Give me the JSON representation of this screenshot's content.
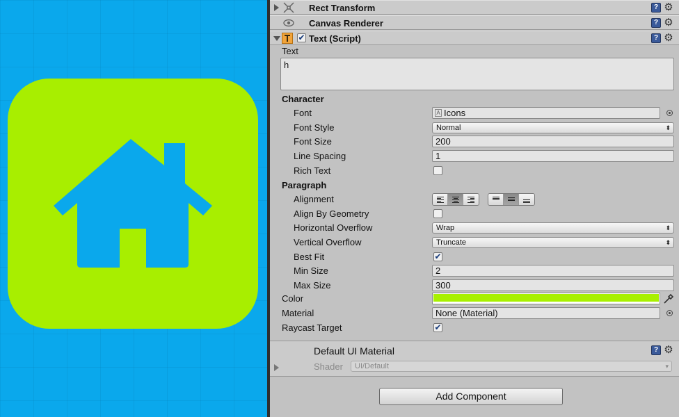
{
  "scene": {
    "background_color": "#0aa8ec",
    "tile_color": "#a8ee00",
    "icon": "house-icon"
  },
  "components": {
    "rect_transform": {
      "title": "Rect Transform",
      "icon": "rect-transform-icon"
    },
    "canvas_renderer": {
      "title": "Canvas Renderer",
      "icon": "eye-icon"
    },
    "text_script": {
      "title": "Text (Script)",
      "icon": "text-t-icon",
      "enabled": true
    }
  },
  "text_component": {
    "text_label": "Text",
    "text_value": "h",
    "character_header": "Character",
    "font_label": "Font",
    "font_value": "Icons",
    "font_style_label": "Font Style",
    "font_style_value": "Normal",
    "font_size_label": "Font Size",
    "font_size_value": "200",
    "line_spacing_label": "Line Spacing",
    "line_spacing_value": "1",
    "rich_text_label": "Rich Text",
    "rich_text_checked": false,
    "paragraph_header": "Paragraph",
    "alignment_label": "Alignment",
    "alignment_horizontal": "center",
    "alignment_vertical": "middle",
    "align_by_geometry_label": "Align By Geometry",
    "align_by_geometry_checked": false,
    "horizontal_overflow_label": "Horizontal Overflow",
    "horizontal_overflow_value": "Wrap",
    "vertical_overflow_label": "Vertical Overflow",
    "vertical_overflow_value": "Truncate",
    "best_fit_label": "Best Fit",
    "best_fit_checked": true,
    "min_size_label": "Min Size",
    "min_size_value": "2",
    "max_size_label": "Max Size",
    "max_size_value": "300",
    "color_label": "Color",
    "color_value": "#a8f000",
    "material_label": "Material",
    "material_value": "None (Material)",
    "raycast_target_label": "Raycast Target",
    "raycast_target_checked": true
  },
  "material_preview": {
    "title": "Default UI Material",
    "shader_label": "Shader",
    "shader_value": "UI/Default"
  },
  "add_component_label": "Add Component",
  "checkmark": "✔",
  "arrow_updown": "⬍",
  "arrow_down": "▾"
}
